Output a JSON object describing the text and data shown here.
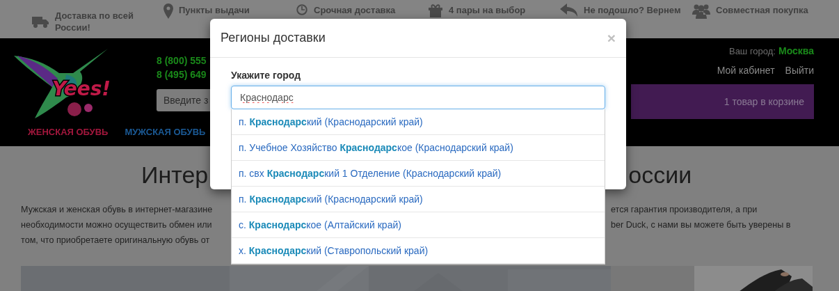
{
  "top_bar": {
    "items": [
      {
        "text": "Доставка по всей России!"
      },
      {
        "text": "Пункты выдачи"
      },
      {
        "text": "Срочная доставка"
      },
      {
        "text": "4 пары на выбор"
      },
      {
        "text": "Не подошло? Вернем"
      },
      {
        "text": "Совместная покупка"
      }
    ]
  },
  "header": {
    "logo_text": "Yees!",
    "phones": [
      "8 (800) 555",
      "8 (495) 649"
    ],
    "search": {
      "placeholder": "Введите з"
    },
    "city_label": "Ваш город:",
    "city": "Москва",
    "account_links": [
      "Мой кабинет",
      "Выйти"
    ],
    "cart": "1 товар в корзине",
    "menu": [
      {
        "label": "ЖЕНСКАЯ ОБУВЬ",
        "color": "#a3173d"
      },
      {
        "label": "МУЖСКАЯ ОБУВЬ",
        "color": "#1b5a96"
      }
    ]
  },
  "content": {
    "heading_parts": [
      "Интер",
      "оссии"
    ],
    "paragraph_left": [
      "Мужская и женская обувь в интернет-магазине",
      "необходимости можно осуществить обмен или",
      "том, что приобретаете оригинальную обувь от"
    ],
    "paragraph_right": [
      "ется гарантия производителя, а при",
      "ber Duck, с нами вы можете быть уверены в"
    ],
    "banners": [
      {
        "kind": "picture"
      },
      {
        "kind": "picture"
      }
    ]
  },
  "modal": {
    "title": "Регионы доставки",
    "close": "×",
    "field_label": "Укажите город",
    "value": "Краснодарс",
    "suggestions": [
      "п. **Краснодарс**кий (Краснодарский край)",
      "п. Учебное Хозяйство **Краснодарс**кое (Краснодарский край)",
      "п. свх **Краснодарс**кий 1 Отделение (Краснодарский край)",
      "п. **Краснодарс**кий (Краснодарский край)",
      "с. **Краснодарс**кое (Алтайский край)",
      "х. **Краснодарс**кий (Ставропольский край)"
    ]
  }
}
